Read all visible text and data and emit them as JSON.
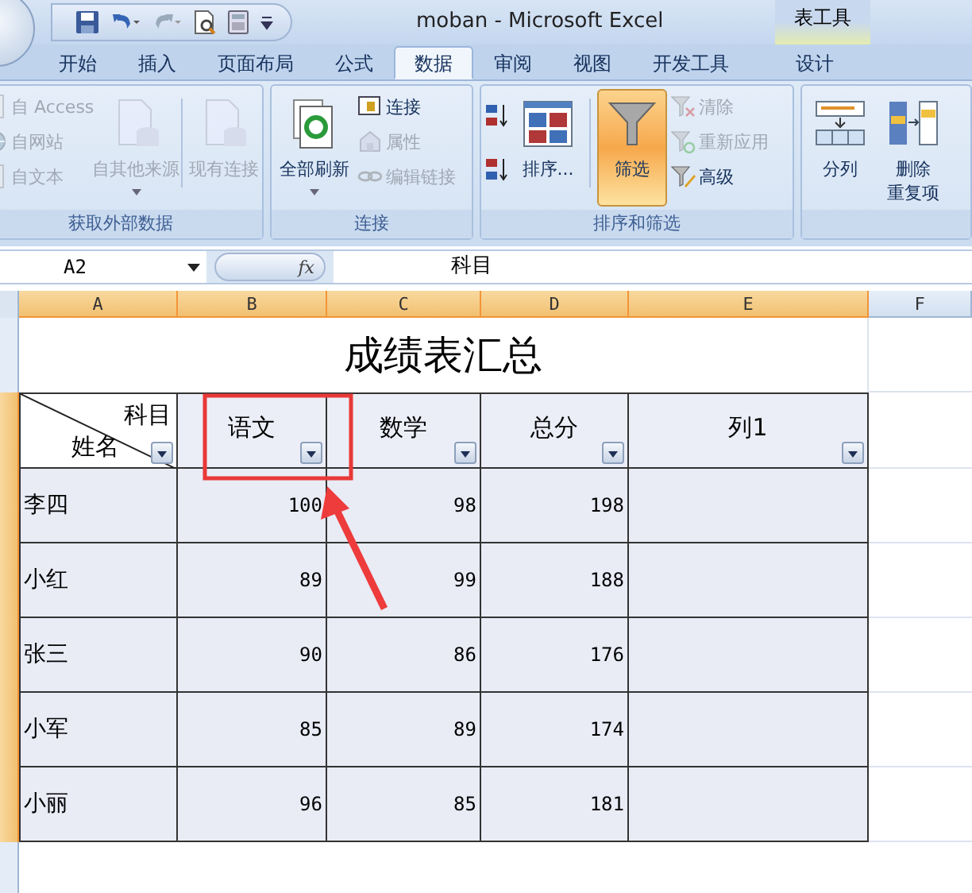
{
  "window": {
    "title": "moban - Microsoft Excel",
    "context_tab": "表工具"
  },
  "ribbon_tabs": [
    {
      "label": "开始",
      "selected": false
    },
    {
      "label": "插入",
      "selected": false
    },
    {
      "label": "页面布局",
      "selected": false
    },
    {
      "label": "公式",
      "selected": false
    },
    {
      "label": "数据",
      "selected": true
    },
    {
      "label": "审阅",
      "selected": false
    },
    {
      "label": "视图",
      "selected": false
    },
    {
      "label": "开发工具",
      "selected": false
    },
    {
      "label": "设计",
      "selected": false
    }
  ],
  "ribbon_groups": [
    {
      "label": "获取外部数据",
      "columns": [
        {
          "kind": "stack",
          "items": [
            {
              "kind": "text",
              "label": "自 Access",
              "disabled": true
            },
            {
              "kind": "text",
              "label": "自网站",
              "disabled": true
            },
            {
              "kind": "text",
              "label": "自文本",
              "disabled": true
            }
          ]
        },
        {
          "kind": "large",
          "label": "自其他来源",
          "disabled": true,
          "dropdown": true,
          "selected": false
        },
        {
          "kind": "separator"
        },
        {
          "kind": "large",
          "label": "现有连接",
          "disabled": true,
          "dropdown": false,
          "selected": false
        }
      ]
    },
    {
      "label": "连接",
      "columns": [
        {
          "kind": "large",
          "label": "全部刷新",
          "disabled": false,
          "dropdown": true,
          "selected": false
        },
        {
          "kind": "stack",
          "items": [
            {
              "kind": "text",
              "label": "连接",
              "disabled": false
            },
            {
              "kind": "text",
              "label": "属性",
              "disabled": true
            },
            {
              "kind": "text",
              "label": "编辑链接",
              "disabled": true
            }
          ]
        }
      ]
    },
    {
      "label": "排序和筛选",
      "columns": [
        {
          "kind": "stack",
          "items": [
            {
              "kind": "icon",
              "disabled": false
            },
            {
              "kind": "icon",
              "disabled": false
            }
          ]
        },
        {
          "kind": "large",
          "label": "排序...",
          "disabled": false,
          "dropdown": false,
          "selected": false
        },
        {
          "kind": "separator"
        },
        {
          "kind": "large",
          "label": "筛选",
          "disabled": false,
          "dropdown": false,
          "selected": true
        },
        {
          "kind": "stack",
          "items": [
            {
              "kind": "text",
              "label": "清除",
              "disabled": true
            },
            {
              "kind": "text",
              "label": "重新应用",
              "disabled": true
            },
            {
              "kind": "text",
              "label": "高级",
              "disabled": false
            }
          ]
        }
      ]
    },
    {
      "columns": [
        {
          "kind": "large",
          "label": "分列",
          "disabled": false,
          "dropdown": false,
          "selected": false
        },
        {
          "kind": "large",
          "lines": [
            "删除",
            "重复项"
          ],
          "disabled": false,
          "dropdown": false,
          "selected": false
        }
      ]
    }
  ],
  "formula_bar": {
    "name_box": "A2",
    "fx_button": "fx",
    "formula": "科目"
  },
  "sheet": {
    "columns": [
      {
        "label": "A",
        "selected": true
      },
      {
        "label": "B",
        "selected": true
      },
      {
        "label": "C",
        "selected": true
      },
      {
        "label": "D",
        "selected": true
      },
      {
        "label": "E",
        "selected": true
      },
      {
        "label": "F",
        "selected": false
      }
    ],
    "title_row": {
      "selected": false,
      "title": "成绩表汇总"
    },
    "header_row": {
      "selected": true,
      "corner_top": "科目",
      "corner_bottom": "姓名",
      "headers": [
        "语文",
        "数学",
        "总分",
        "列1"
      ]
    },
    "rows": [
      {
        "selected": true,
        "name": "李四",
        "values": [
          "100",
          "98",
          "198"
        ]
      },
      {
        "selected": true,
        "name": "小红",
        "values": [
          "89",
          "99",
          "188"
        ]
      },
      {
        "selected": true,
        "name": "张三",
        "values": [
          "90",
          "86",
          "176"
        ]
      },
      {
        "selected": true,
        "name": "小军",
        "values": [
          "85",
          "89",
          "174"
        ]
      },
      {
        "selected": true,
        "name": "小丽",
        "values": [
          "96",
          "85",
          "181"
        ]
      }
    ]
  }
}
